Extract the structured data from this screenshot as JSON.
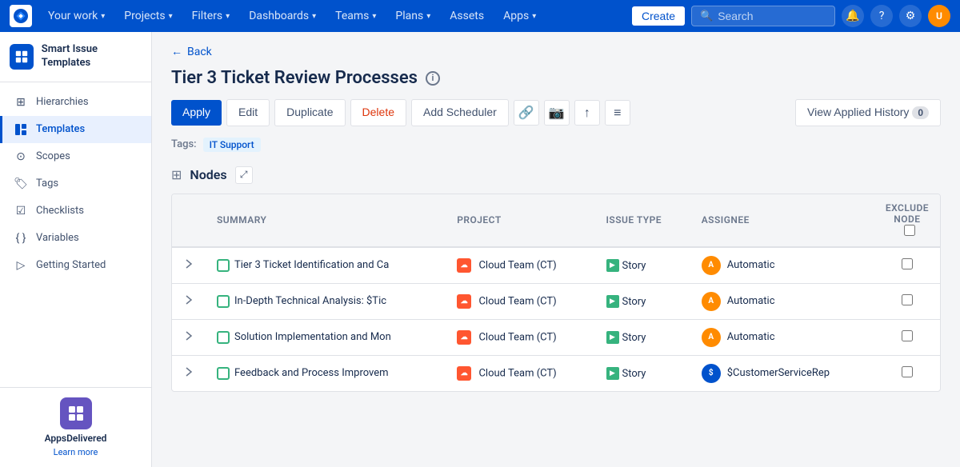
{
  "nav": {
    "logo_text": "J",
    "items": [
      {
        "label": "Your work",
        "has_dropdown": true
      },
      {
        "label": "Projects",
        "has_dropdown": true
      },
      {
        "label": "Filters",
        "has_dropdown": true
      },
      {
        "label": "Dashboards",
        "has_dropdown": true
      },
      {
        "label": "Teams",
        "has_dropdown": true
      },
      {
        "label": "Plans",
        "has_dropdown": true
      },
      {
        "label": "Assets",
        "has_dropdown": false
      },
      {
        "label": "Apps",
        "has_dropdown": true
      }
    ],
    "search_placeholder": "Search",
    "create_label": "Create"
  },
  "sidebar": {
    "logo_text": "Smart Issue Templates",
    "items": [
      {
        "label": "Hierarchies",
        "icon": "⊞"
      },
      {
        "label": "Templates",
        "icon": "◧",
        "active": true
      },
      {
        "label": "Scopes",
        "icon": "⊙"
      },
      {
        "label": "Tags",
        "icon": "◈"
      },
      {
        "label": "Checklists",
        "icon": "☑"
      },
      {
        "label": "Variables",
        "icon": "◻"
      },
      {
        "label": "Getting Started",
        "icon": "▷"
      }
    ],
    "bottom": {
      "app_name": "AppsDelivered",
      "learn_more": "Learn more"
    }
  },
  "back_label": "Back",
  "page_title": "Tier 3 Ticket Review Processes",
  "toolbar": {
    "apply_label": "Apply",
    "edit_label": "Edit",
    "duplicate_label": "Duplicate",
    "delete_label": "Delete",
    "add_scheduler_label": "Add Scheduler",
    "view_history_label": "View Applied History",
    "history_count": "0"
  },
  "tags": {
    "label": "Tags:",
    "values": [
      "IT Support"
    ]
  },
  "nodes_section": {
    "title": "Nodes",
    "columns": {
      "summary": "Summary",
      "project": "Project",
      "issue_type": "Issue Type",
      "assignee": "Assignee",
      "exclude_node": "Exclude Node"
    },
    "rows": [
      {
        "summary": "Tier 3 Ticket Identification and Ca",
        "project_name": "Cloud Team (CT)",
        "issue_type": "Story",
        "assignee": "Automatic",
        "has_children": true
      },
      {
        "summary": "In-Depth Technical Analysis: $Tic",
        "project_name": "Cloud Team (CT)",
        "issue_type": "Story",
        "assignee": "Automatic",
        "has_children": true
      },
      {
        "summary": "Solution Implementation and Mon",
        "project_name": "Cloud Team (CT)",
        "issue_type": "Story",
        "assignee": "Automatic",
        "has_children": true
      },
      {
        "summary": "Feedback and Process Improvem",
        "project_name": "Cloud Team (CT)",
        "issue_type": "Story",
        "assignee": "$CustomerServiceRep",
        "has_children": true
      }
    ]
  }
}
